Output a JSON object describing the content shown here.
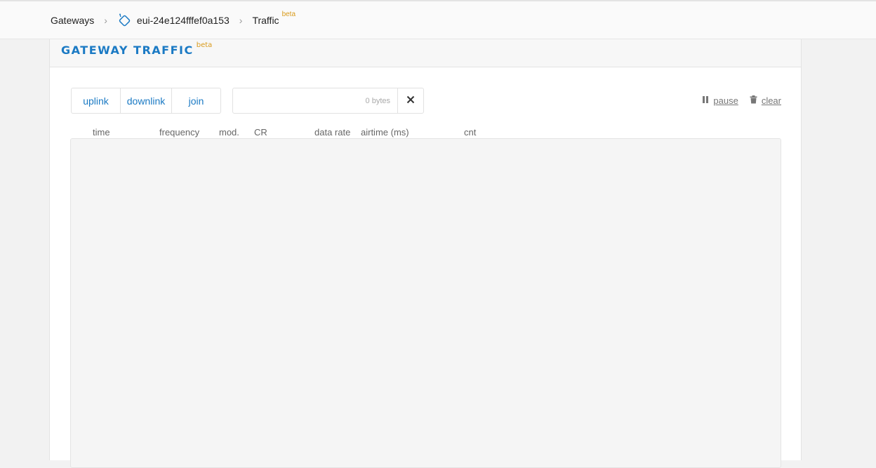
{
  "breadcrumb": {
    "gateways_label": "Gateways",
    "gateway_id": "eui-24e124fffef0a153",
    "current_label": "Traffic",
    "beta_label": "beta",
    "separator": "›"
  },
  "panel": {
    "title": "GATEWAY TRAFFIC",
    "beta_label": "beta"
  },
  "filters": [
    {
      "label": "uplink"
    },
    {
      "label": "downlink"
    },
    {
      "label": "join"
    }
  ],
  "search": {
    "value": "",
    "placeholder": "0 bytes"
  },
  "actions": {
    "pause_label": "pause",
    "clear_label": "clear"
  },
  "columns": [
    "time",
    "frequency",
    "mod.",
    "CR",
    "data rate",
    "airtime (ms)",
    "cnt"
  ],
  "colors": {
    "accent": "#1b7ac4",
    "beta": "#d99b1c"
  },
  "icons": {
    "gateway": "gateway-icon",
    "close": "close-icon",
    "pause": "pause-icon",
    "trash": "trash-icon"
  }
}
